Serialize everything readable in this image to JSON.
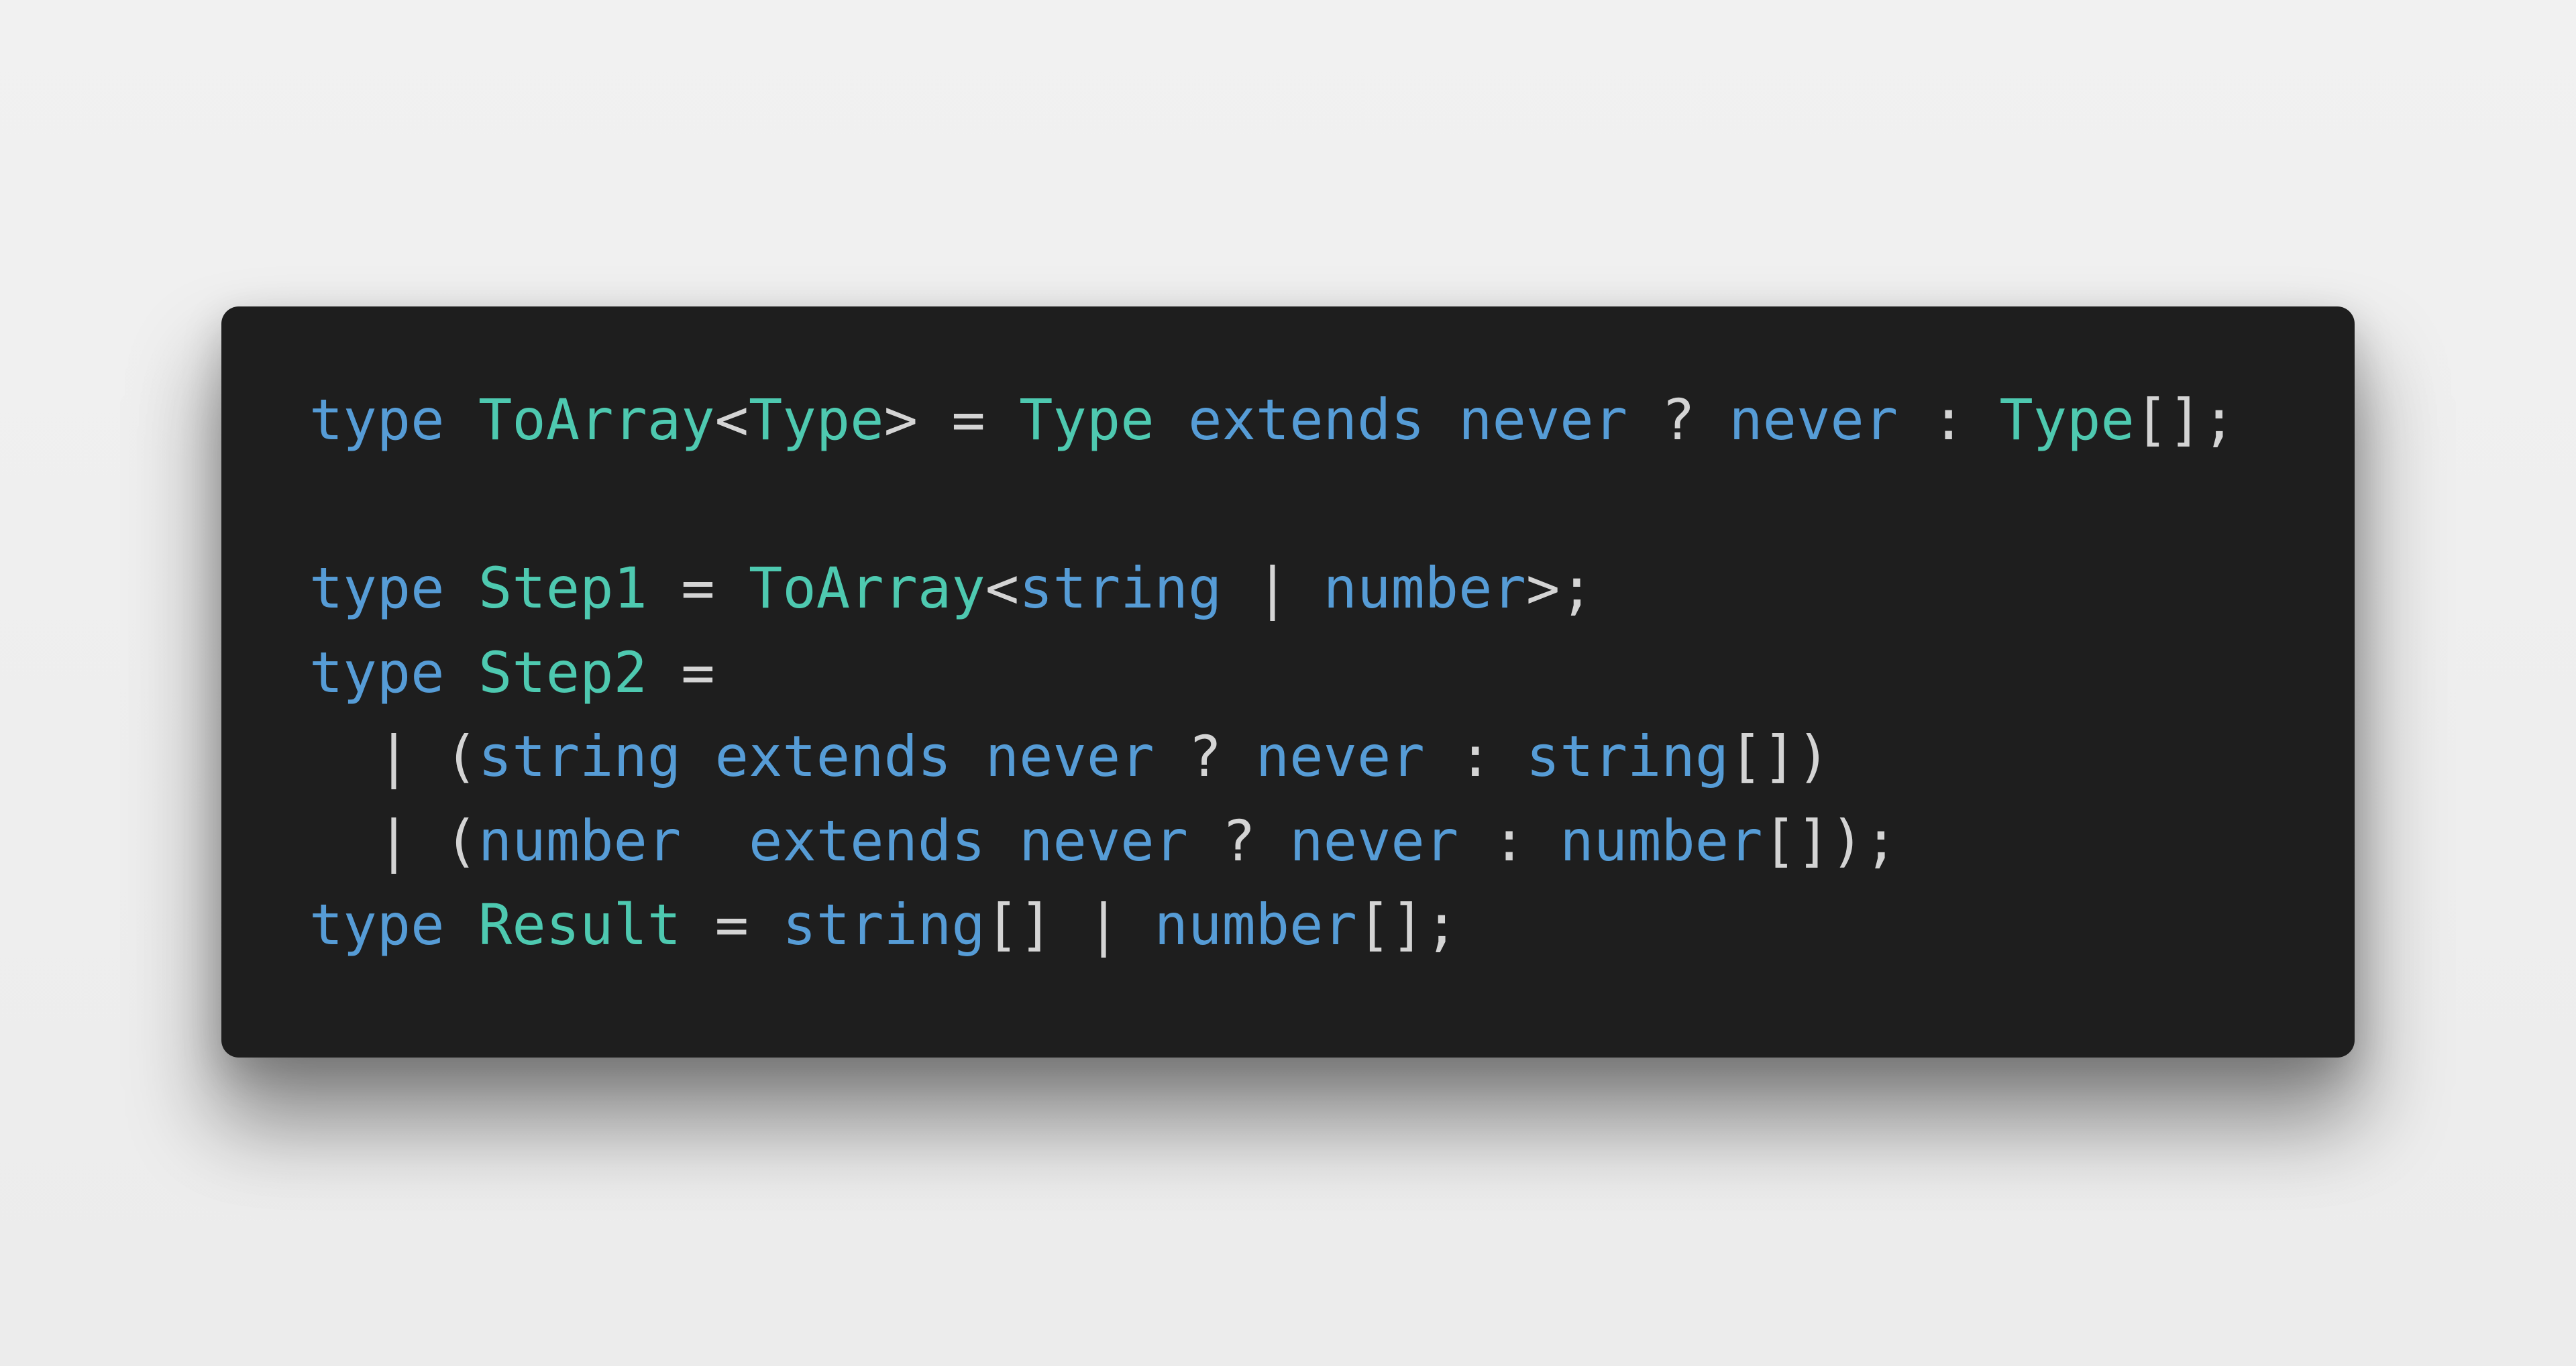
{
  "colors": {
    "background": "#f0f0f0",
    "card_background": "#1e1e1e",
    "keyword": "#569cd6",
    "type_name": "#4ec9b0",
    "builtin_type": "#569cd6",
    "punctuation": "#d4d4d4"
  },
  "code": {
    "language": "typescript",
    "lines": [
      {
        "tokens": [
          {
            "t": "type",
            "k": "keyword"
          },
          {
            "t": " ",
            "k": "space"
          },
          {
            "t": "ToArray",
            "k": "type"
          },
          {
            "t": "<",
            "k": "punct"
          },
          {
            "t": "Type",
            "k": "type"
          },
          {
            "t": ">",
            "k": "punct"
          },
          {
            "t": " = ",
            "k": "punct"
          },
          {
            "t": "Type",
            "k": "type"
          },
          {
            "t": " ",
            "k": "space"
          },
          {
            "t": "extends",
            "k": "keyword"
          },
          {
            "t": " ",
            "k": "space"
          },
          {
            "t": "never",
            "k": "builtin"
          },
          {
            "t": " ? ",
            "k": "punct"
          },
          {
            "t": "never",
            "k": "builtin"
          },
          {
            "t": " : ",
            "k": "punct"
          },
          {
            "t": "Type",
            "k": "type"
          },
          {
            "t": "[];",
            "k": "punct"
          }
        ]
      },
      {
        "tokens": []
      },
      {
        "tokens": [
          {
            "t": "type",
            "k": "keyword"
          },
          {
            "t": " ",
            "k": "space"
          },
          {
            "t": "Step1",
            "k": "type"
          },
          {
            "t": " = ",
            "k": "punct"
          },
          {
            "t": "ToArray",
            "k": "type"
          },
          {
            "t": "<",
            "k": "punct"
          },
          {
            "t": "string",
            "k": "builtin"
          },
          {
            "t": " | ",
            "k": "punct"
          },
          {
            "t": "number",
            "k": "builtin"
          },
          {
            "t": ">;",
            "k": "punct"
          }
        ]
      },
      {
        "tokens": [
          {
            "t": "type",
            "k": "keyword"
          },
          {
            "t": " ",
            "k": "space"
          },
          {
            "t": "Step2",
            "k": "type"
          },
          {
            "t": " =",
            "k": "punct"
          }
        ]
      },
      {
        "tokens": [
          {
            "t": "  | (",
            "k": "punct"
          },
          {
            "t": "string",
            "k": "builtin"
          },
          {
            "t": " ",
            "k": "space"
          },
          {
            "t": "extends",
            "k": "keyword"
          },
          {
            "t": " ",
            "k": "space"
          },
          {
            "t": "never",
            "k": "builtin"
          },
          {
            "t": " ? ",
            "k": "punct"
          },
          {
            "t": "never",
            "k": "builtin"
          },
          {
            "t": " : ",
            "k": "punct"
          },
          {
            "t": "string",
            "k": "builtin"
          },
          {
            "t": "[])",
            "k": "punct"
          }
        ]
      },
      {
        "tokens": [
          {
            "t": "  | (",
            "k": "punct"
          },
          {
            "t": "number",
            "k": "builtin"
          },
          {
            "t": "  ",
            "k": "space"
          },
          {
            "t": "extends",
            "k": "keyword"
          },
          {
            "t": " ",
            "k": "space"
          },
          {
            "t": "never",
            "k": "builtin"
          },
          {
            "t": " ? ",
            "k": "punct"
          },
          {
            "t": "never",
            "k": "builtin"
          },
          {
            "t": " : ",
            "k": "punct"
          },
          {
            "t": "number",
            "k": "builtin"
          },
          {
            "t": "[]);",
            "k": "punct"
          }
        ]
      },
      {
        "tokens": [
          {
            "t": "type",
            "k": "keyword"
          },
          {
            "t": " ",
            "k": "space"
          },
          {
            "t": "Result",
            "k": "type"
          },
          {
            "t": " = ",
            "k": "punct"
          },
          {
            "t": "string",
            "k": "builtin"
          },
          {
            "t": "[] | ",
            "k": "punct"
          },
          {
            "t": "number",
            "k": "builtin"
          },
          {
            "t": "[];",
            "k": "punct"
          }
        ]
      }
    ]
  }
}
